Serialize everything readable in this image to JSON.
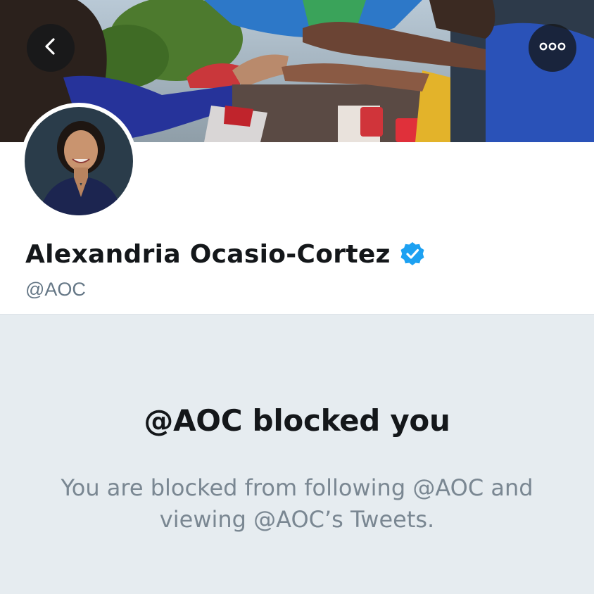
{
  "profile": {
    "display_name": "Alexandria Ocasio-Cortez",
    "handle": "@AOC",
    "verified": true
  },
  "header": {
    "back_icon": "chevron-left-icon",
    "more_icon": "more-horizontal-icon"
  },
  "blocked": {
    "title": "@AOC blocked you",
    "description": "You are blocked from following @AOC and viewing @AOC’s Tweets."
  },
  "colors": {
    "verified_badge": "#1da1f2",
    "panel_background": "#e6ecf0",
    "secondary_text": "#657786",
    "primary_text": "#14171a"
  }
}
